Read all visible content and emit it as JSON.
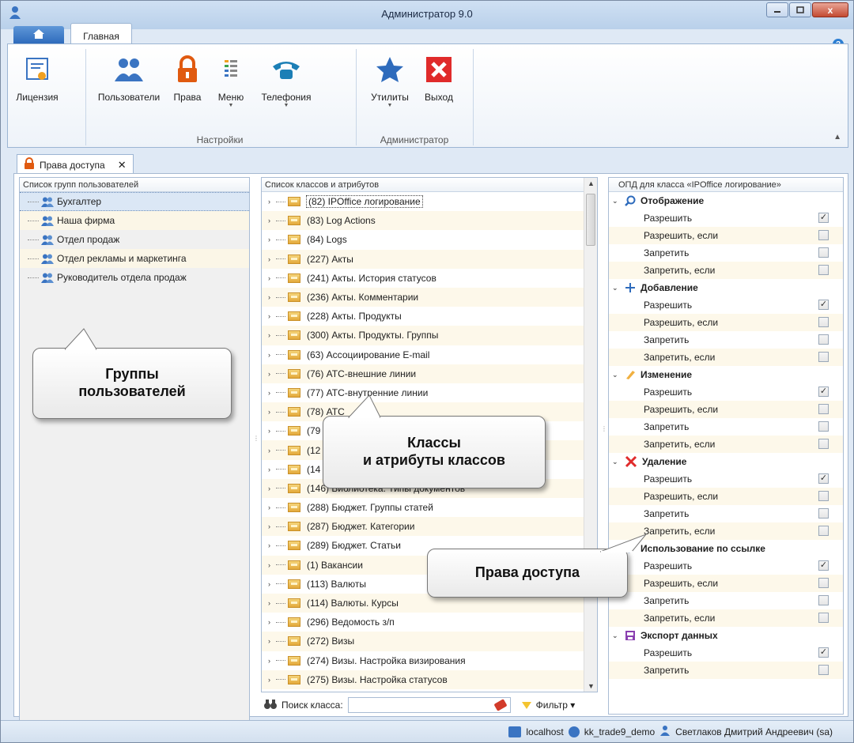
{
  "window": {
    "title": "Администратор 9.0",
    "close_symbol": "x"
  },
  "ribbon": {
    "home_tab_icon": "home-icon",
    "active_tab": "Главная",
    "help_symbol": "?",
    "buttons": [
      {
        "label": "Лицензия",
        "icon": "certificate-icon"
      },
      {
        "label": "Пользователи",
        "icon": "users-icon"
      },
      {
        "label": "Права",
        "icon": "lock-icon"
      },
      {
        "label": "Меню",
        "icon": "menu-icon"
      },
      {
        "label": "Телефония",
        "icon": "phone-icon"
      },
      {
        "label": "Утилиты",
        "icon": "star-icon"
      },
      {
        "label": "Выход",
        "icon": "exit-icon"
      }
    ],
    "groups": [
      "Настройки",
      "Администратор"
    ]
  },
  "doc_tab": {
    "label": "Права доступа",
    "close": "✕"
  },
  "groups_panel": {
    "header": "Список групп пользователей",
    "items": [
      "Бухгалтер",
      "Наша фирма",
      "Отдел продаж",
      "Отдел рекламы и маркетинга",
      "Руководитель отдела продаж"
    ]
  },
  "classes_panel": {
    "header": "Список классов и атрибутов",
    "items": [
      "(82) IPOffice логирование",
      "(83) Log Actions",
      "(84) Logs",
      "(227) Акты",
      "(241) Акты. История статусов",
      "(236) Акты. Комментарии",
      "(228) Акты. Продукты",
      "(300) Акты. Продукты. Группы",
      "(63) Ассоциирование E-mail",
      "(76) АТС-внешние линии",
      "(77) АТС-внутренние линии",
      "(78) АТС",
      "(79",
      "(12",
      "(14",
      "(146) Библиотека. Типы документов",
      "(288) Бюджет. Группы статей",
      "(287) Бюджет. Категории",
      "(289) Бюджет. Статьи",
      "(1) Вакансии",
      "(113) Валюты",
      "(114) Валюты. Курсы",
      "(296) Ведомость з/п",
      "(272) Визы",
      "(274) Визы. Настройка визирования",
      "(275) Визы. Настройка статусов"
    ],
    "search_label": "Поиск класса:",
    "search_value": "",
    "filter_label": "Фильтр ▾"
  },
  "permissions_panel": {
    "header": "ОПД для класса «IPOffice логирование»",
    "sections": [
      {
        "title": "Отображение",
        "icon": "search-icon",
        "rows": [
          {
            "label": "Разрешить",
            "checked": "✓"
          },
          {
            "label": "Разрешить, если",
            "checked": ""
          },
          {
            "label": "Запретить",
            "checked": ""
          },
          {
            "label": "Запретить, если",
            "checked": ""
          }
        ]
      },
      {
        "title": "Добавление",
        "icon": "plus-icon",
        "rows": [
          {
            "label": "Разрешить",
            "checked": "✓"
          },
          {
            "label": "Разрешить, если",
            "checked": ""
          },
          {
            "label": "Запретить",
            "checked": ""
          },
          {
            "label": "Запретить, если",
            "checked": ""
          }
        ]
      },
      {
        "title": "Изменение",
        "icon": "pencil-icon",
        "rows": [
          {
            "label": "Разрешить",
            "checked": "✓"
          },
          {
            "label": "Разрешить, если",
            "checked": ""
          },
          {
            "label": "Запретить",
            "checked": ""
          },
          {
            "label": "Запретить, если",
            "checked": ""
          }
        ]
      },
      {
        "title": "Удаление",
        "icon": "delete-icon",
        "rows": [
          {
            "label": "Разрешить",
            "checked": "✓"
          },
          {
            "label": "Разрешить, если",
            "checked": ""
          },
          {
            "label": "Запретить",
            "checked": ""
          },
          {
            "label": "Запретить, если",
            "checked": ""
          }
        ]
      },
      {
        "title": "Использование по ссылке",
        "icon": "link-icon",
        "rows": [
          {
            "label": "Разрешить",
            "checked": "✓"
          },
          {
            "label": "Разрешить, если",
            "checked": ""
          },
          {
            "label": "Запретить",
            "checked": ""
          },
          {
            "label": "Запретить, если",
            "checked": ""
          }
        ]
      },
      {
        "title": "Экспорт данных",
        "icon": "export-icon",
        "rows": [
          {
            "label": "Разрешить",
            "checked": "✓"
          },
          {
            "label": "Запретить",
            "checked": ""
          }
        ]
      }
    ]
  },
  "callouts": {
    "groups": "Группы\nпользователей",
    "classes": "Классы\nи атрибуты классов",
    "rights": "Права доступа"
  },
  "statusbar": {
    "server": "localhost",
    "database": "kk_trade9_demo",
    "user": "Светлаков Дмитрий Андреевич (sa)"
  }
}
